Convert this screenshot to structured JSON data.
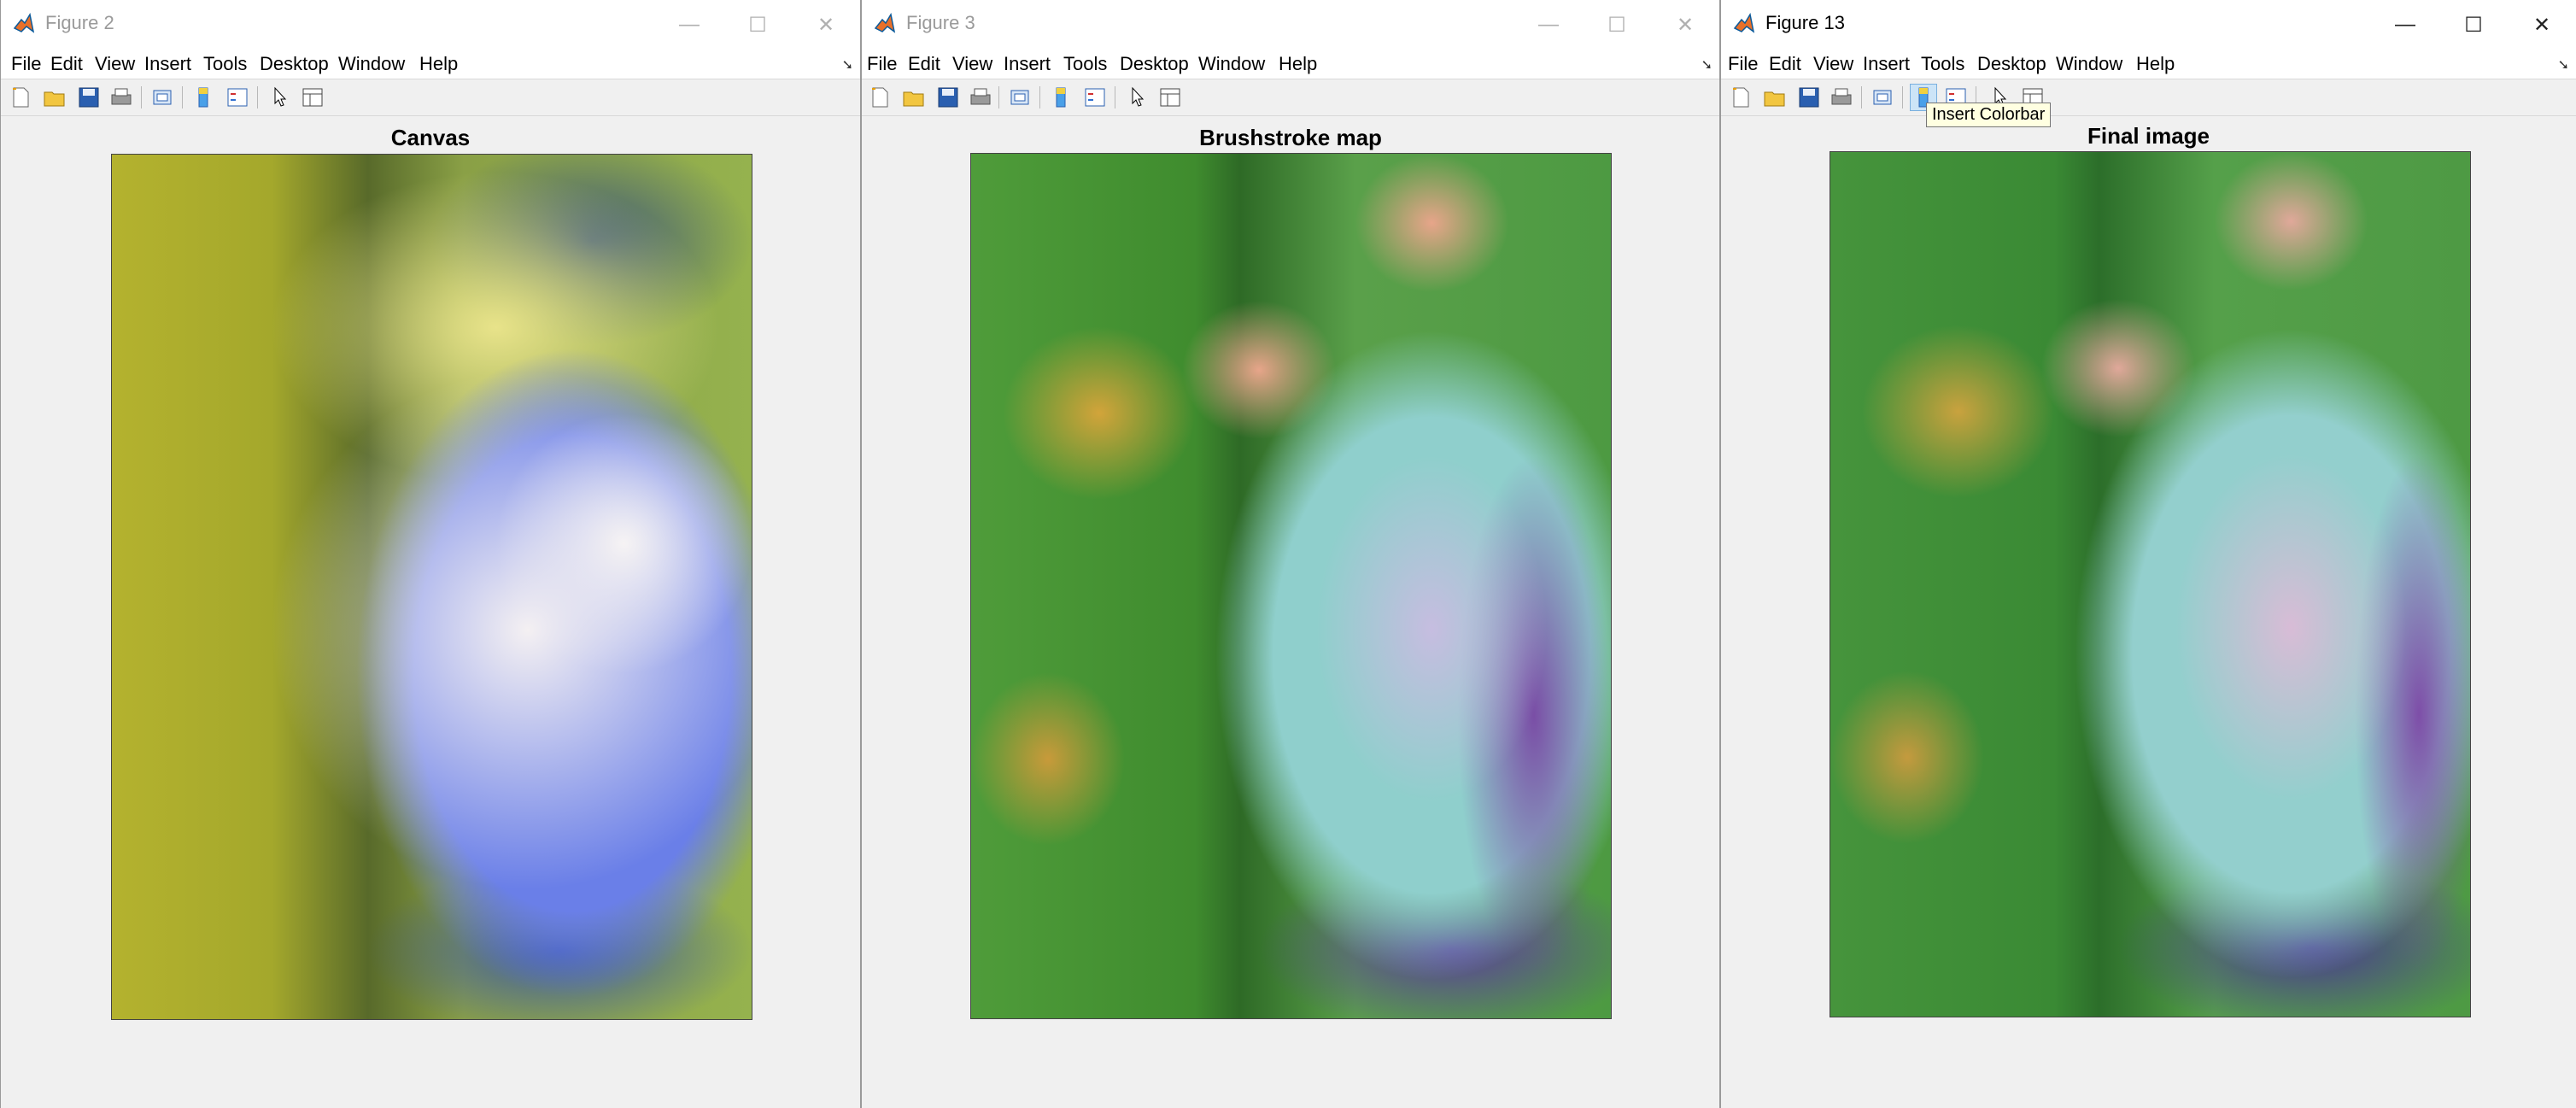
{
  "windows": [
    {
      "title": "Figure 2",
      "active": false,
      "menu": [
        "File",
        "Edit",
        "View",
        "Insert",
        "Tools",
        "Desktop",
        "Window",
        "Help"
      ],
      "figure_title": "Canvas"
    },
    {
      "title": "Figure 3",
      "active": false,
      "menu": [
        "File",
        "Edit",
        "View",
        "Insert",
        "Tools",
        "Desktop",
        "Window",
        "Help"
      ],
      "figure_title": "Brushstroke map"
    },
    {
      "title": "Figure 13",
      "active": true,
      "menu": [
        "File",
        "Edit",
        "View",
        "Insert",
        "Tools",
        "Desktop",
        "Window",
        "Help"
      ],
      "figure_title": "Final image",
      "tooltip": "Insert Colorbar"
    }
  ],
  "window_controls": {
    "minimize": "—",
    "maximize": "☐",
    "close": "✕"
  },
  "toolbar_icons": [
    "new-figure-icon",
    "open-file-icon",
    "save-icon",
    "print-icon",
    "link-plot-icon",
    "insert-colorbar-icon",
    "insert-legend-icon",
    "edit-plot-icon",
    "property-inspector-icon"
  ],
  "colors": {
    "title_active": "#000000",
    "title_inactive": "#9a9a9a",
    "window_bg": "#f0f0f0",
    "tooltip_bg": "#ffffe1"
  }
}
